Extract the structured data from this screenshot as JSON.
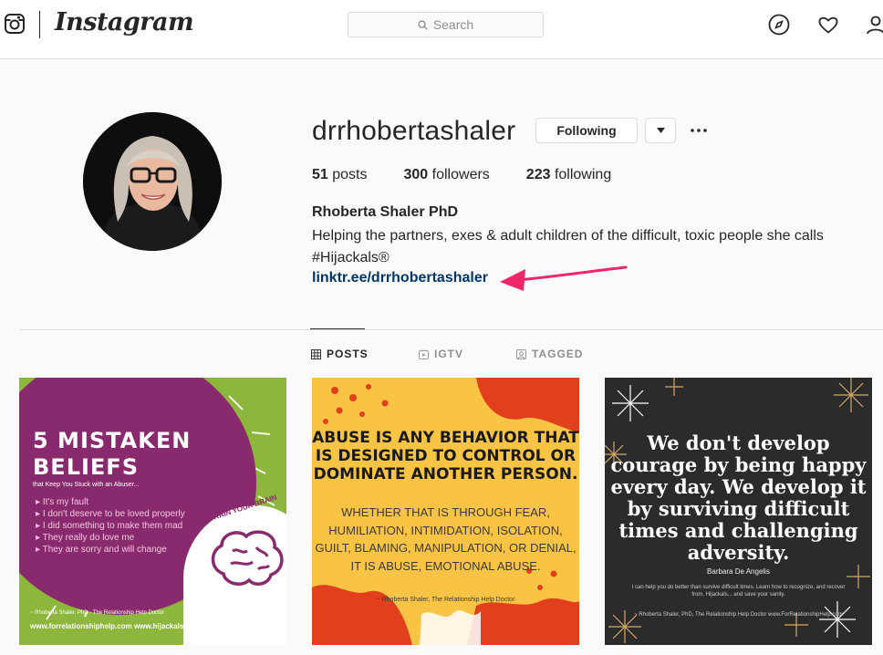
{
  "nav": {
    "wordmark": "Instagram",
    "search_placeholder": "Search",
    "icons": [
      "instagram-glyph-icon",
      "search-icon",
      "compass-icon",
      "heart-icon",
      "profile-icon"
    ]
  },
  "profile": {
    "username": "drrhobertashaler",
    "following_label": "Following",
    "posts_count": "51",
    "posts_label": "posts",
    "followers_count": "300",
    "followers_label": "followers",
    "following_count": "223",
    "following_stat_label": "following",
    "full_name": "Rhoberta Shaler PhD",
    "bio": "Helping the partners, exes & adult children of the difficult, toxic people she calls #Hijackals®",
    "link": "linktr.ee/drrhobertashaler"
  },
  "tabs": [
    {
      "label": "POSTS",
      "icon": "grid-icon",
      "active": true
    },
    {
      "label": "IGTV",
      "icon": "igtv-icon",
      "active": false
    },
    {
      "label": "TAGGED",
      "icon": "tagged-icon",
      "active": false
    }
  ],
  "posts": [
    {
      "title": "5 MISTAKEN BELIEFS",
      "subtitle": "that Keep You Stuck with an Abuser...",
      "items": [
        "It's my fault",
        "I don't deserve to be loved properly",
        "I did something to make them mad",
        "They really do love me",
        "They are sorry and will change"
      ],
      "badge": "RETRAIN YOUR BRAIN",
      "footer": "~ Rhoberta Shaler, PhD - The Relationship Help Doctor",
      "urls": "www.forrelationshiphelp.com    www.hijackals.com"
    },
    {
      "title": "ABUSE IS ANY BEHAVIOR THAT IS DESIGNED TO CONTROL OR DOMINATE ANOTHER PERSON.",
      "body": "WHETHER THAT IS THROUGH FEAR, HUMILIATION, INTIMIDATION, ISOLATION, GUILT, BLAMING, MANIPULATION, OR DENIAL, IT IS ABUSE, EMOTIONAL ABUSE.",
      "attribution": "~ Rhoberta Shaler, The Relationship Help Doctor"
    },
    {
      "quote": "We don't develop courage by being happy every day. We develop it by surviving difficult times and challenging adversity.",
      "author": "Barbara De Angelis",
      "small": "I can help you do better than survive difficult times. Learn how to recognize, and recover from, Hijackals... and save your sanity.",
      "footer": "~ Rhoberta Shaler, PhD, The Relationship Help Doctor www.ForRelationshipHelp.com"
    }
  ],
  "colors": {
    "link": "#00376b",
    "annotation_arrow": "#f0266a"
  }
}
